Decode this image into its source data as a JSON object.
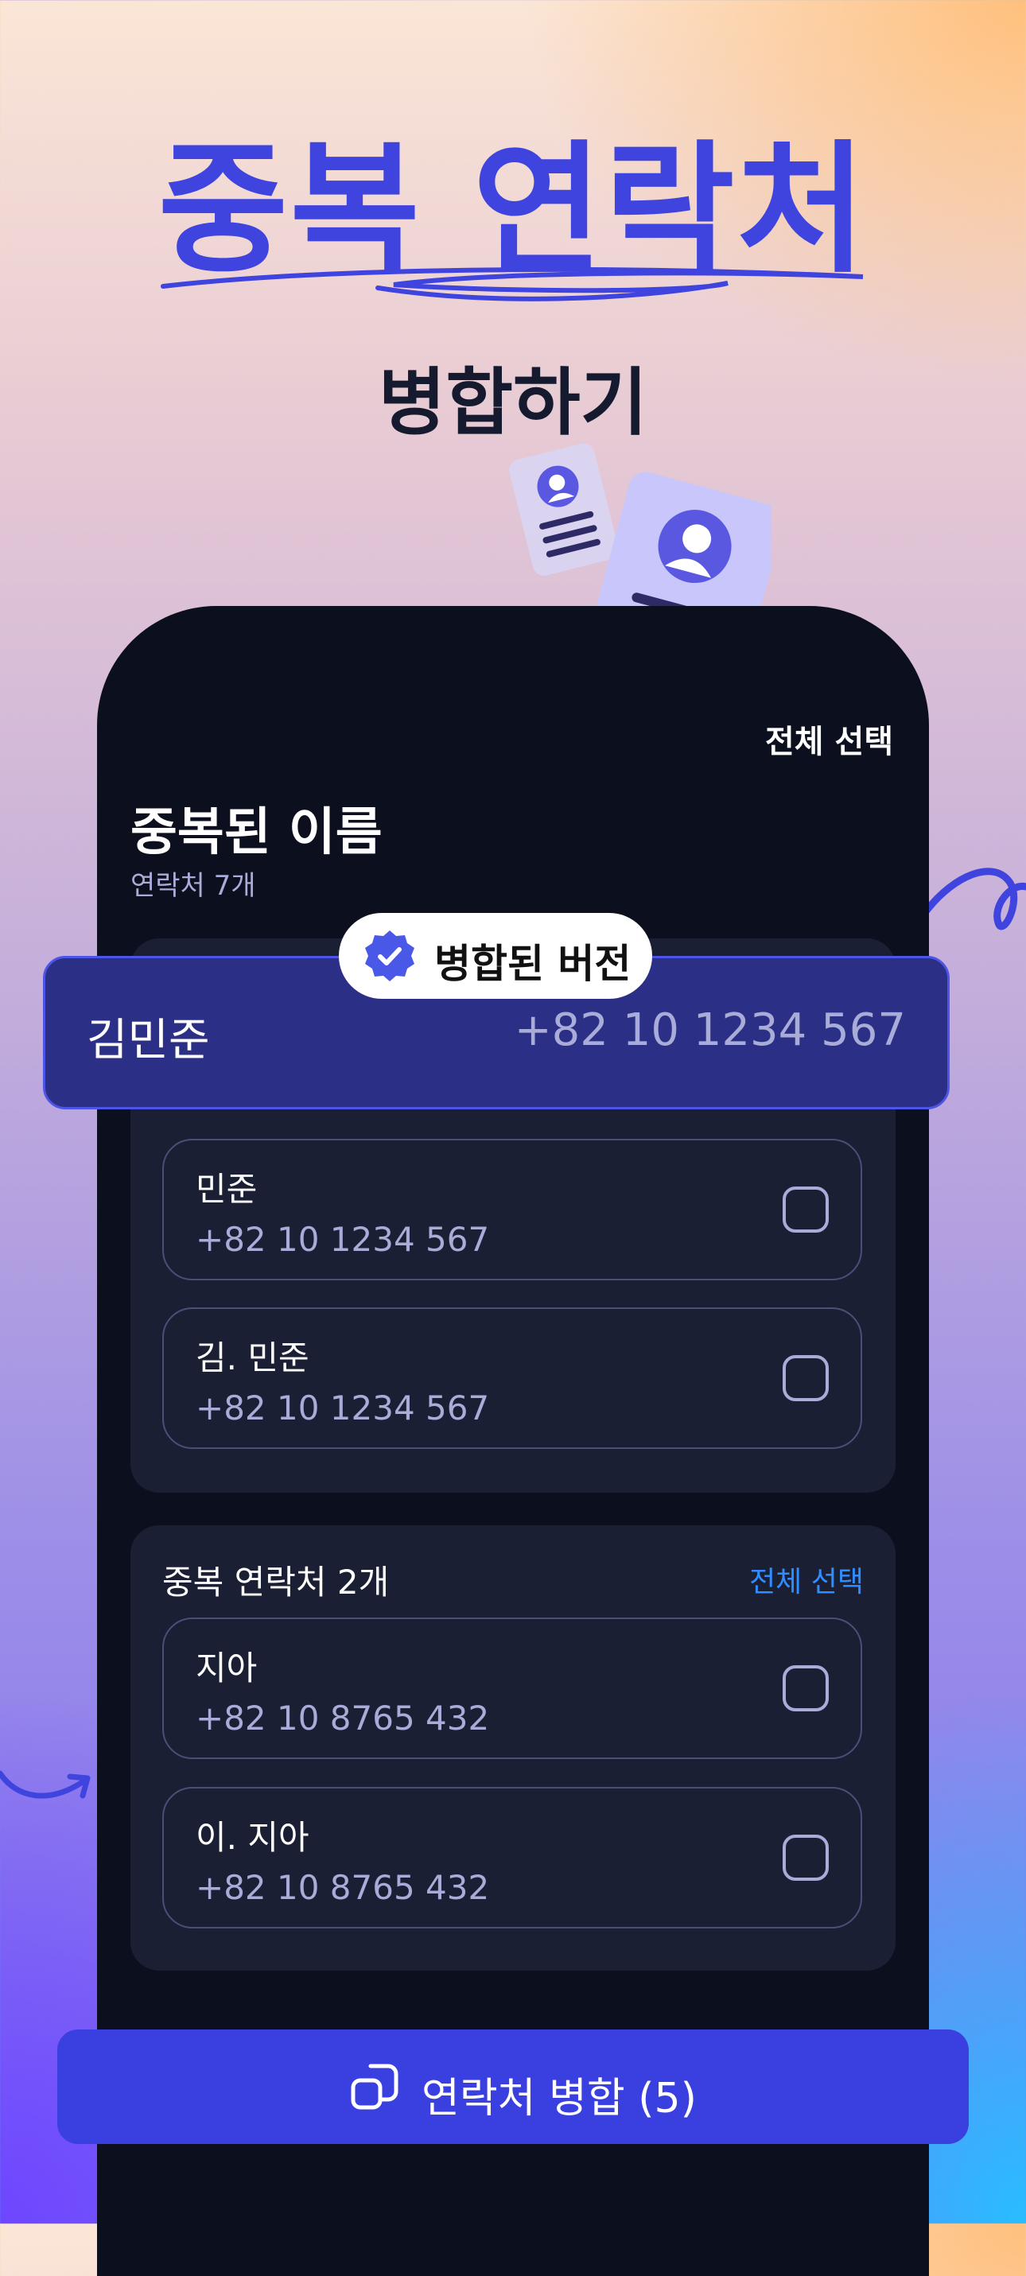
{
  "hero": {
    "headline": "중복 연락처",
    "subheadline": "병합하기"
  },
  "screen": {
    "select_all_top": "전체 선택",
    "title": "중복된 이름",
    "subtitle": "연락처 7개"
  },
  "merged": {
    "badge_label": "병합된 버전",
    "name": "김민준",
    "phone": "+82 10 1234 567"
  },
  "group_a": {
    "rows": [
      {
        "name": "민준",
        "phone": "+82 10 1234 567",
        "checked": false
      },
      {
        "name": "김. 민준",
        "phone": "+82 10 1234 567",
        "checked": false
      }
    ]
  },
  "group_b": {
    "title": "중복 연락처 2개",
    "action": "전체 선택",
    "rows": [
      {
        "name": "지아",
        "phone": "+82 10 8765 432",
        "checked": false
      },
      {
        "name": "이. 지아",
        "phone": "+82 10 8765 432",
        "checked": false
      }
    ]
  },
  "merge_button": {
    "label": "연락처 병합 (5)"
  },
  "colors": {
    "accent": "#3f44de",
    "link": "#2f8dff",
    "panel": "#0c0f1d",
    "card": "#1b1f33"
  }
}
